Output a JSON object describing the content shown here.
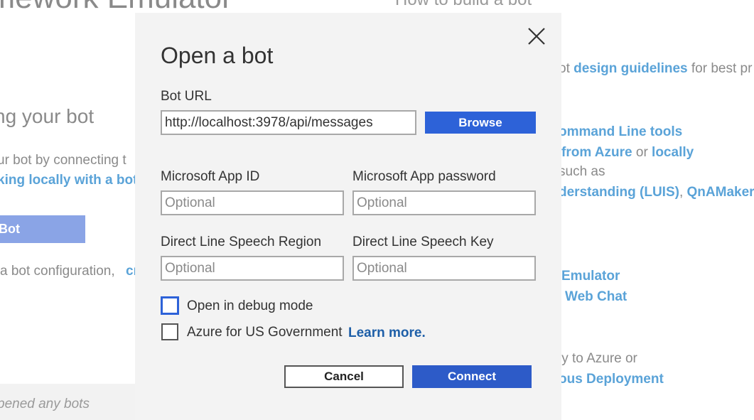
{
  "background": {
    "app_title": "amework Emulator",
    "howto_heading": "How to build a bot",
    "section_heading": "ng your bot",
    "intro_text": "ur bot by connecting t",
    "intro_link": "king locally with a bot",
    "open_bot_button": "Bot",
    "config_text": "a bot configuration,",
    "config_link": "cr",
    "footer_text": "pened any bots",
    "right": {
      "line1_prefix": "ot ",
      "line1_link": "design guidelines",
      "line1_suffix": " for best pr",
      "link_cli": "ommand Line tools",
      "link_azure": "from Azure",
      "or_text": " or ",
      "link_locally": "locally",
      "such_as": "such as",
      "link_luis": "derstanding (LUIS)",
      "comma": ", ",
      "link_qna": "QnAMaker",
      "link_emulator": "Emulator",
      "link_webchat": "Web Chat",
      "deploy_text": "ly to Azure or",
      "link_deploy": "ous Deployment"
    }
  },
  "dialog": {
    "title": "Open a bot",
    "bot_url_label": "Bot URL",
    "bot_url_value": "http://localhost:3978/api/messages",
    "browse_label": "Browse",
    "app_id_label": "Microsoft App ID",
    "app_id_placeholder": "Optional",
    "app_password_label": "Microsoft App password",
    "app_password_placeholder": "Optional",
    "speech_region_label": "Direct Line Speech Region",
    "speech_region_placeholder": "Optional",
    "speech_key_label": "Direct Line Speech Key",
    "speech_key_placeholder": "Optional",
    "debug_mode_label": "Open in debug mode",
    "debug_mode_checked": false,
    "gov_label": "Azure for US Government",
    "gov_checked": false,
    "learn_more": "Learn more.",
    "cancel_label": "Cancel",
    "connect_label": "Connect"
  },
  "colors": {
    "primary": "#2d5bc8",
    "link": "#1e5fa8",
    "dialog_bg": "#f3f3f3"
  }
}
